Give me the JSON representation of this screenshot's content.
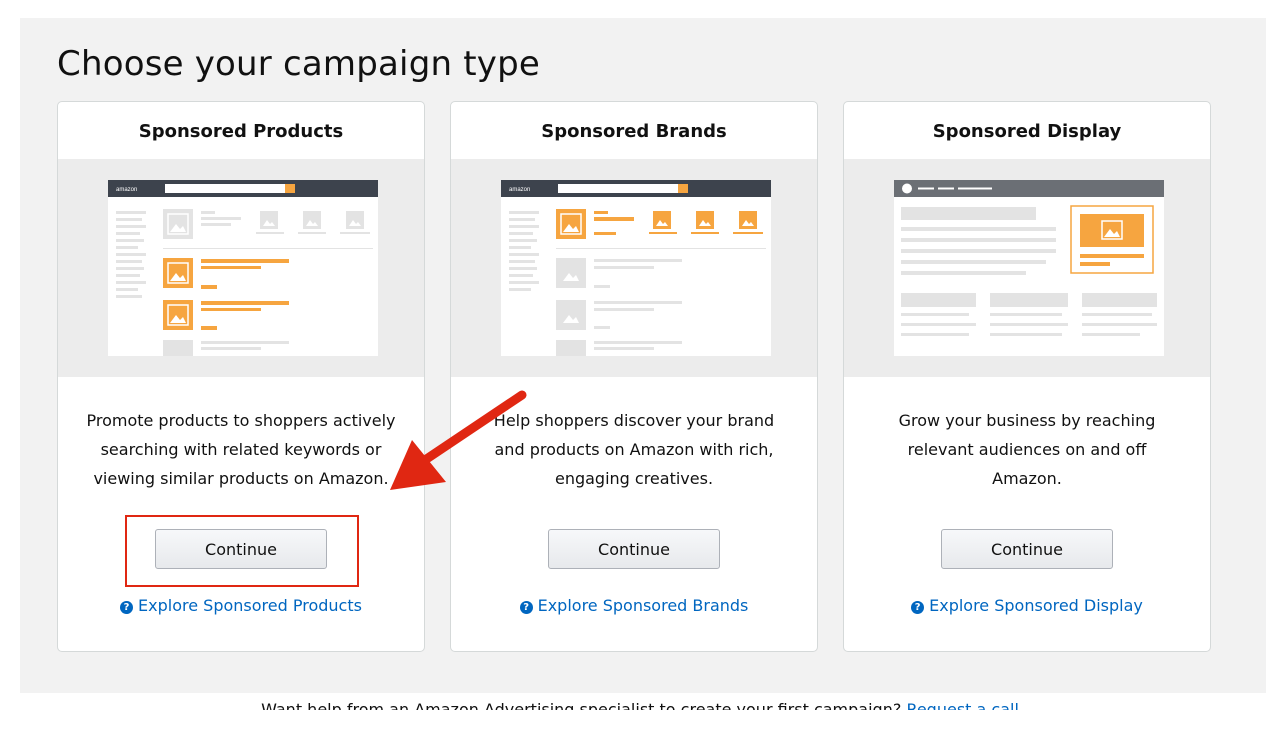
{
  "page": {
    "title": "Choose your campaign type"
  },
  "cards": [
    {
      "title": "Sponsored Products",
      "description": "Promote products to shoppers actively searching with related keywords or viewing similar products on Amazon.",
      "button_label": "Continue",
      "link_label": "Explore Sponsored Products"
    },
    {
      "title": "Sponsored Brands",
      "description": "Help shoppers discover your brand and products on Amazon with rich, engaging creatives.",
      "button_label": "Continue",
      "link_label": "Explore Sponsored Brands"
    },
    {
      "title": "Sponsored Display",
      "description": "Grow your business by reaching relevant audiences on and off Amazon.",
      "button_label": "Continue",
      "link_label": "Explore Sponsored Display"
    }
  ],
  "illustration": {
    "logo_text": "amazon"
  },
  "help_icon_glyph": "?",
  "footer": {
    "text": "Want help from an Amazon Advertising specialist to create your first campaign?",
    "link_label": "Request a call"
  },
  "colors": {
    "accent_orange": "#f6a540",
    "link_blue": "#0066c0",
    "annotation_red": "#e02712",
    "header_dark": "#3d434d"
  }
}
